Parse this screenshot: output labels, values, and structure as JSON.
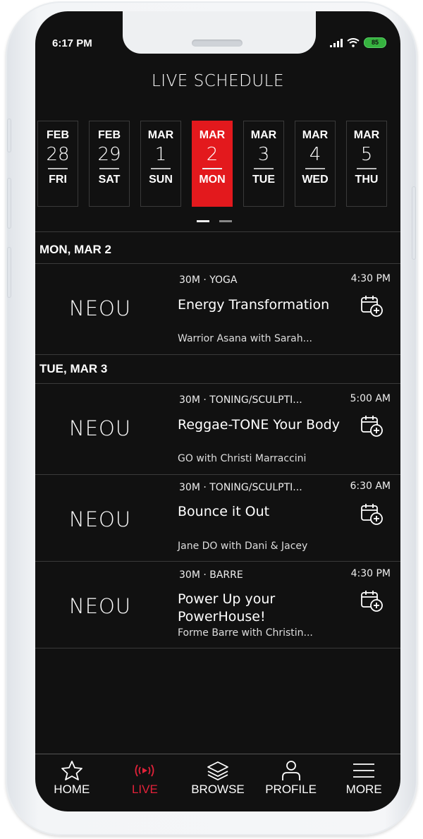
{
  "status_bar": {
    "time": "6:17 PM",
    "battery": "85"
  },
  "header": {
    "title": "LIVE SCHEDULE"
  },
  "days": [
    {
      "month": "FEB",
      "day": "28",
      "weekday": "FRI",
      "selected": false
    },
    {
      "month": "FEB",
      "day": "29",
      "weekday": "SAT",
      "selected": false
    },
    {
      "month": "MAR",
      "day": "1",
      "weekday": "SUN",
      "selected": false
    },
    {
      "month": "MAR",
      "day": "2",
      "weekday": "MON",
      "selected": true
    },
    {
      "month": "MAR",
      "day": "3",
      "weekday": "TUE",
      "selected": false
    },
    {
      "month": "MAR",
      "day": "4",
      "weekday": "WED",
      "selected": false
    },
    {
      "month": "MAR",
      "day": "5",
      "weekday": "THU",
      "selected": false
    }
  ],
  "pager": {
    "pages": 2,
    "current": 1
  },
  "sections": [
    {
      "heading": "MON, MAR 2",
      "classes": [
        {
          "logo": "NEOU",
          "meta": "30M · YOGA",
          "time": "4:30 PM",
          "name": "Energy Transformation",
          "instructor": "Warrior Asana with Sarah..."
        }
      ]
    },
    {
      "heading": "TUE, MAR 3",
      "classes": [
        {
          "logo": "NEOU",
          "meta": "30M · TONING/SCULPTI...",
          "time": "5:00 AM",
          "name": "Reggae-TONE Your Body",
          "instructor": "GO with Christi Marraccini"
        },
        {
          "logo": "NEOU",
          "meta": "30M · TONING/SCULPTI...",
          "time": "6:30 AM",
          "name": "Bounce it Out",
          "instructor": "Jane DO with Dani & Jacey"
        },
        {
          "logo": "NEOU",
          "meta": "30M · BARRE",
          "time": "4:30 PM",
          "name": "Power Up your PowerHouse!",
          "instructor": "Forme Barre with Christin..."
        }
      ]
    }
  ],
  "tabbar": {
    "items": [
      {
        "label": "HOME",
        "icon": "star-icon"
      },
      {
        "label": "LIVE",
        "icon": "live-broadcast-icon",
        "active": true
      },
      {
        "label": "BROWSE",
        "icon": "layers-icon"
      },
      {
        "label": "PROFILE",
        "icon": "person-icon"
      },
      {
        "label": "MORE",
        "icon": "menu-icon"
      }
    ]
  },
  "colors": {
    "accent": "#e3191d",
    "background": "#111111",
    "battery": "#36b23f"
  }
}
